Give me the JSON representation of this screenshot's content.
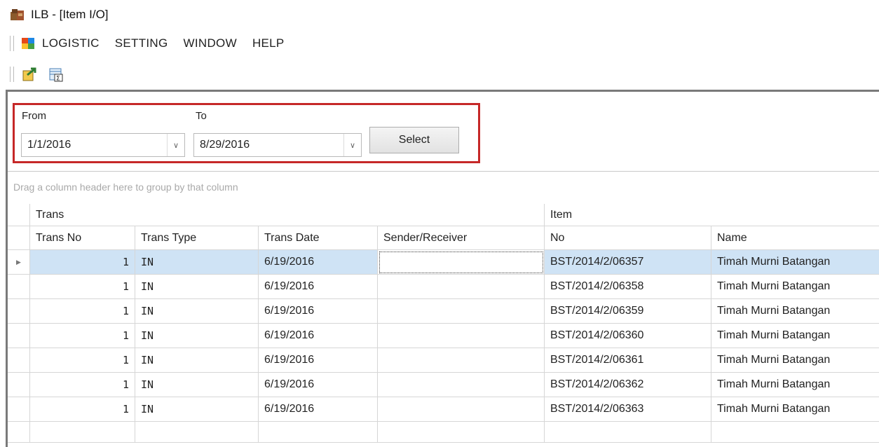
{
  "window": {
    "title": "ILB - [Item I/O]"
  },
  "menu": {
    "items": [
      "LOGISTIC",
      "SETTING",
      "WINDOW",
      "HELP"
    ]
  },
  "toolbar": {
    "icons": [
      "export-icon",
      "summary-icon"
    ]
  },
  "filter": {
    "from_label": "From",
    "to_label": "To",
    "from_value": "1/1/2016",
    "to_value": "8/29/2016",
    "select_label": "Select"
  },
  "grid": {
    "group_hint": "Drag a column header here to group by that column",
    "bands": {
      "trans": "Trans",
      "item": "Item"
    },
    "columns": [
      "Trans No",
      "Trans Type",
      "Trans Date",
      "Sender/Receiver",
      "No",
      "Name"
    ],
    "rows": [
      {
        "trans_no": "1",
        "trans_type": "IN",
        "trans_date": "6/19/2016",
        "sender": "",
        "item_no": "BST/2014/2/06357",
        "name": "Timah Murni Batangan"
      },
      {
        "trans_no": "1",
        "trans_type": "IN",
        "trans_date": "6/19/2016",
        "sender": "",
        "item_no": "BST/2014/2/06358",
        "name": "Timah Murni Batangan"
      },
      {
        "trans_no": "1",
        "trans_type": "IN",
        "trans_date": "6/19/2016",
        "sender": "",
        "item_no": "BST/2014/2/06359",
        "name": "Timah Murni Batangan"
      },
      {
        "trans_no": "1",
        "trans_type": "IN",
        "trans_date": "6/19/2016",
        "sender": "",
        "item_no": "BST/2014/2/06360",
        "name": "Timah Murni Batangan"
      },
      {
        "trans_no": "1",
        "trans_type": "IN",
        "trans_date": "6/19/2016",
        "sender": "",
        "item_no": "BST/2014/2/06361",
        "name": "Timah Murni Batangan"
      },
      {
        "trans_no": "1",
        "trans_type": "IN",
        "trans_date": "6/19/2016",
        "sender": "",
        "item_no": "BST/2014/2/06362",
        "name": "Timah Murni Batangan"
      },
      {
        "trans_no": "1",
        "trans_type": "IN",
        "trans_date": "6/19/2016",
        "sender": "",
        "item_no": "BST/2014/2/06363",
        "name": "Timah Murni Batangan"
      }
    ]
  },
  "colors": {
    "selection": "#cfe3f5",
    "highlight_border": "#c62828",
    "mdi_border": "#7a7a7a"
  }
}
